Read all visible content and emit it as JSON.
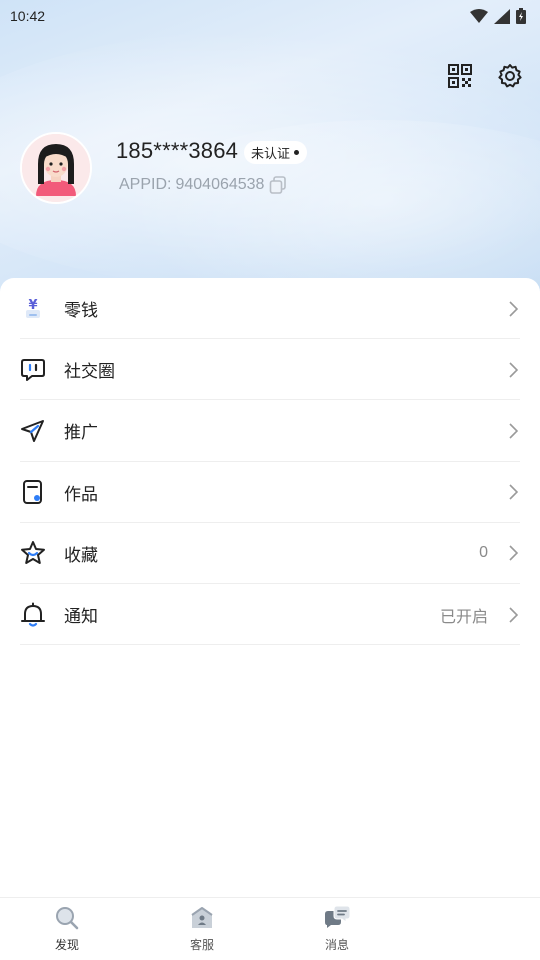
{
  "status_bar": {
    "time": "10:42"
  },
  "profile": {
    "phone": "185****3864",
    "cert_badge": "未认证",
    "appid_label": "APPID:",
    "appid_value": "9404064538"
  },
  "menu": [
    {
      "label": "零钱",
      "value": "",
      "icon": "wallet-icon"
    },
    {
      "label": "社交圈",
      "value": "",
      "icon": "chat-bubble-icon"
    },
    {
      "label": "推广",
      "value": "",
      "icon": "paper-plane-icon"
    },
    {
      "label": "作品",
      "value": "",
      "icon": "document-icon"
    },
    {
      "label": "收藏",
      "value": "0",
      "icon": "star-icon"
    },
    {
      "label": "通知",
      "value": "已开启",
      "icon": "bell-icon"
    }
  ],
  "bottom_nav": [
    {
      "label": "发现",
      "icon": "search-icon"
    },
    {
      "label": "客服",
      "icon": "customer-service-icon"
    },
    {
      "label": "消息",
      "icon": "message-icon"
    }
  ],
  "colors": {
    "accent_blue": "#2f7ef7",
    "header_bg": "#d5e6f8"
  }
}
